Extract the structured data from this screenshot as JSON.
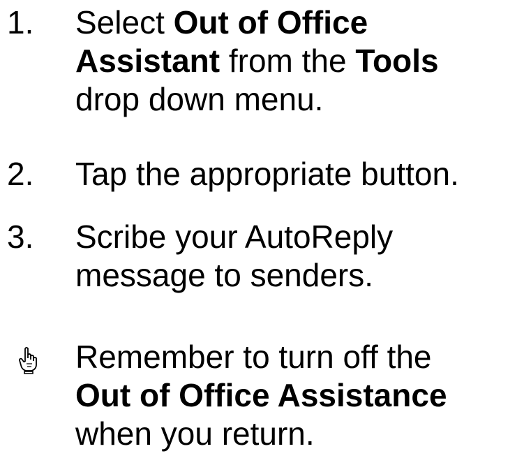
{
  "steps": [
    {
      "number": "1.",
      "parts": {
        "t1": "Select ",
        "b1": "Out of Office",
        "b2": "Assistant",
        "t2": " from the ",
        "b3": "Tools",
        "t3": "drop down menu."
      }
    },
    {
      "number": "2.",
      "text": "Tap the appropriate button."
    },
    {
      "number": "3.",
      "line1": "Scribe your AutoReply",
      "line2": "message to senders."
    }
  ],
  "note": {
    "icon": "pointing-hand-icon",
    "line1": " Remember to turn off the",
    "bold": "Out of Office Assistance",
    "line3": "when you return."
  },
  "colors": {
    "text": "#000000",
    "background": "#ffffff"
  }
}
